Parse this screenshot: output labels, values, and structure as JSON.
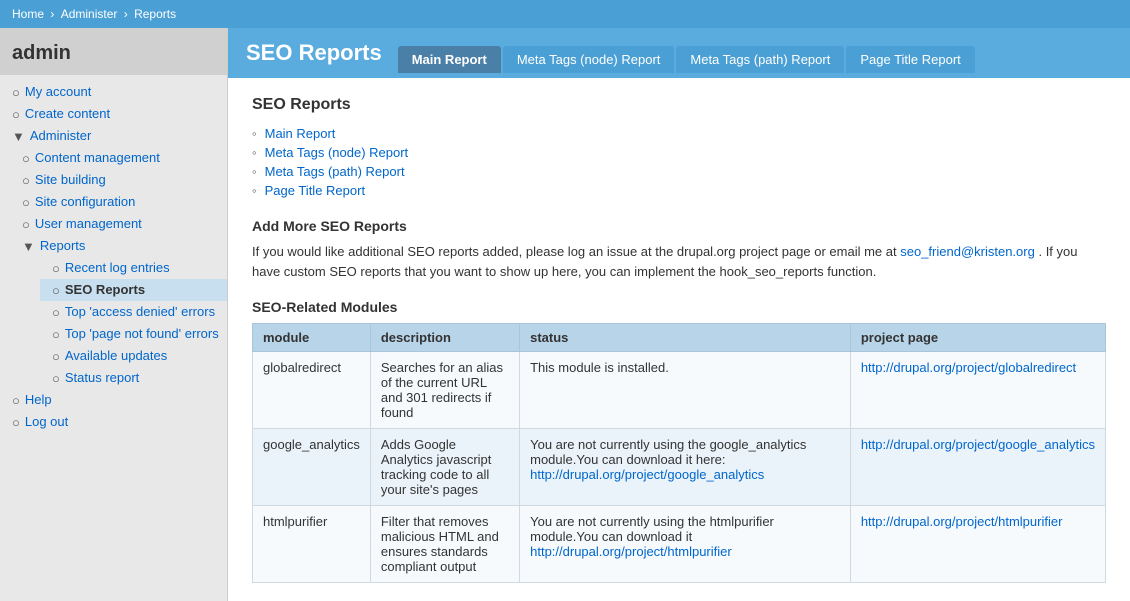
{
  "topbar": {
    "breadcrumbs": [
      {
        "label": "Home",
        "href": "#"
      },
      {
        "label": "Administer",
        "href": "#"
      },
      {
        "label": "Reports",
        "href": "#"
      }
    ],
    "separator": "›"
  },
  "sidebar": {
    "title": "admin",
    "nav": [
      {
        "label": "My account",
        "href": "#",
        "level": 1,
        "bullet": "○",
        "active": false
      },
      {
        "label": "Create content",
        "href": "#",
        "level": 1,
        "bullet": "○",
        "active": false
      },
      {
        "label": "Administer",
        "href": "#",
        "level": 1,
        "bullet": "▼",
        "active": false
      },
      {
        "label": "Content management",
        "href": "#",
        "level": 2,
        "bullet": "○",
        "active": false
      },
      {
        "label": "Site building",
        "href": "#",
        "level": 2,
        "bullet": "○",
        "active": false
      },
      {
        "label": "Site configuration",
        "href": "#",
        "level": 2,
        "bullet": "○",
        "active": false
      },
      {
        "label": "User management",
        "href": "#",
        "level": 2,
        "bullet": "○",
        "active": false
      },
      {
        "label": "Reports",
        "href": "#",
        "level": 2,
        "bullet": "▼",
        "active": false
      },
      {
        "label": "Recent log entries",
        "href": "#",
        "level": 3,
        "bullet": "○",
        "active": false
      },
      {
        "label": "SEO Reports",
        "href": "#",
        "level": 3,
        "bullet": "○",
        "active": true
      },
      {
        "label": "Top 'access denied' errors",
        "href": "#",
        "level": 3,
        "bullet": "○",
        "active": false
      },
      {
        "label": "Top 'page not found' errors",
        "href": "#",
        "level": 3,
        "bullet": "○",
        "active": false
      },
      {
        "label": "Available updates",
        "href": "#",
        "level": 3,
        "bullet": "○",
        "active": false
      },
      {
        "label": "Status report",
        "href": "#",
        "level": 3,
        "bullet": "○",
        "active": false
      },
      {
        "label": "Help",
        "href": "#",
        "level": 1,
        "bullet": "○",
        "active": false
      },
      {
        "label": "Log out",
        "href": "#",
        "level": 1,
        "bullet": "○",
        "active": false
      }
    ]
  },
  "header": {
    "page_title": "SEO Reports",
    "tabs": [
      {
        "label": "Main Report",
        "active": true
      },
      {
        "label": "Meta Tags (node) Report",
        "active": false
      },
      {
        "label": "Meta Tags (path) Report",
        "active": false
      },
      {
        "label": "Page Title Report",
        "active": false
      }
    ]
  },
  "content": {
    "section_title": "SEO Reports",
    "report_links": [
      {
        "label": "Main Report",
        "href": "#"
      },
      {
        "label": "Meta Tags (node) Report",
        "href": "#"
      },
      {
        "label": "Meta Tags (path) Report",
        "href": "#"
      },
      {
        "label": "Page Title Report",
        "href": "#"
      }
    ],
    "add_more_title": "Add More SEO Reports",
    "add_more_text_before": "If you would like additional SEO reports added, please log an issue at the drupal.org project page or email me at",
    "add_more_email": "seo_friend@kristen.org",
    "add_more_text_after": ". If you have custom SEO reports that you want to show up here, you can implement the hook_seo_reports function.",
    "modules_title": "SEO-Related Modules",
    "modules_table": {
      "headers": [
        "module",
        "description",
        "status",
        "project page"
      ],
      "rows": [
        {
          "module": "globalredirect",
          "description": "Searches for an alias of the current URL and 301 redirects if found",
          "status": "This module is installed.",
          "project_page_label": "http://drupal.org/project/globalredirect",
          "project_page_href": "#"
        },
        {
          "module": "google_analytics",
          "description": "Adds Google Analytics javascript tracking code to all your site's pages",
          "status_before": "You are not currently using the google_analytics module.You can download it here: ",
          "status_link_label": "http://drupal.org/project/google_analytics",
          "status_link_href": "#",
          "status_after": "",
          "project_page_label": "http://drupal.org/project/google_analytics",
          "project_page_href": "#"
        },
        {
          "module": "htmlpurifier",
          "description": "Filter that removes malicious HTML and ensures standards compliant output",
          "status_before": "You are not currently using the htmlpurifier module.You can download it",
          "status_link_label": "http://drupal.org/project/htmlpurifier",
          "status_link_href": "#",
          "project_page_label": "http://drupal.org/project/htmlpurifier",
          "project_page_href": "#"
        }
      ]
    }
  }
}
